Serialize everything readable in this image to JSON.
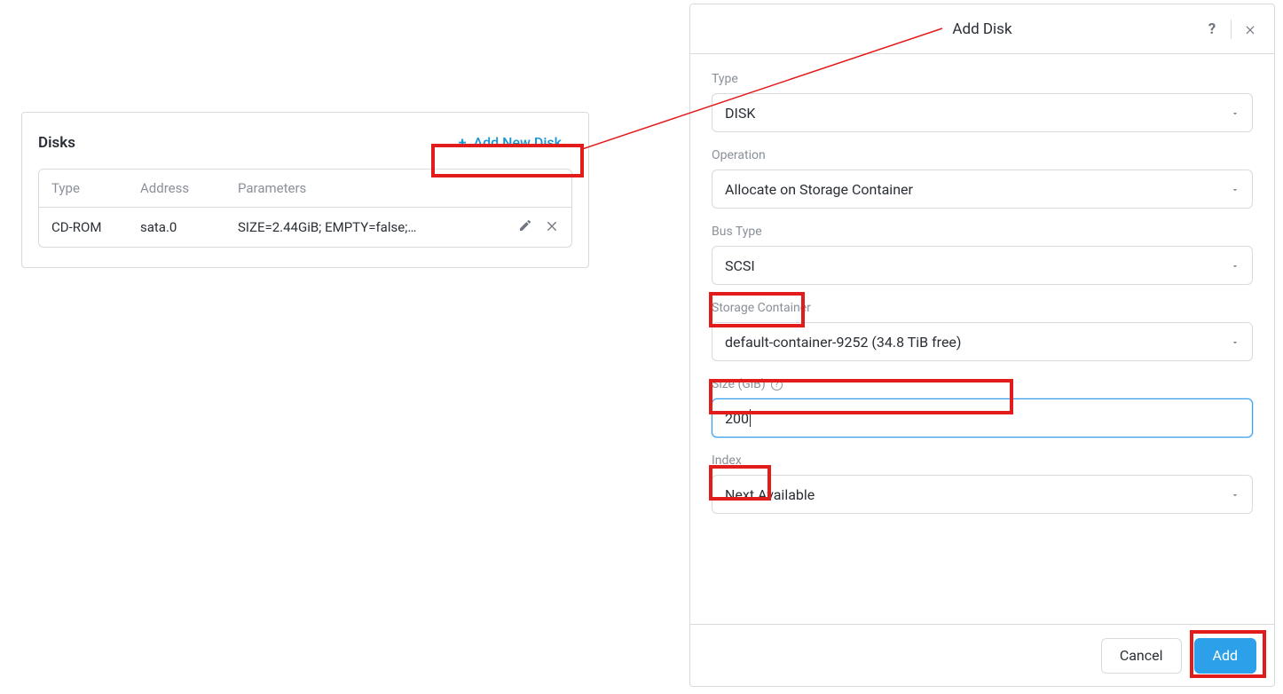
{
  "disks_panel": {
    "title": "Disks",
    "add_button_label": "Add New Disk",
    "columns": {
      "type": "Type",
      "address": "Address",
      "parameters": "Parameters"
    },
    "rows": [
      {
        "type": "CD-ROM",
        "address": "sata.0",
        "parameters": "SIZE=2.44GiB; EMPTY=false;…"
      }
    ]
  },
  "modal": {
    "title": "Add Disk",
    "fields": {
      "type": {
        "label": "Type",
        "value": "DISK"
      },
      "operation": {
        "label": "Operation",
        "value": "Allocate on Storage Container"
      },
      "bus_type": {
        "label": "Bus Type",
        "value": "SCSI"
      },
      "container": {
        "label": "Storage Container",
        "value": "default-container-9252 (34.8 TiB free)"
      },
      "size": {
        "label": "Size (GiB)",
        "value": "200"
      },
      "index": {
        "label": "Index",
        "value": "Next Available"
      }
    },
    "footer": {
      "cancel": "Cancel",
      "submit": "Add"
    }
  }
}
